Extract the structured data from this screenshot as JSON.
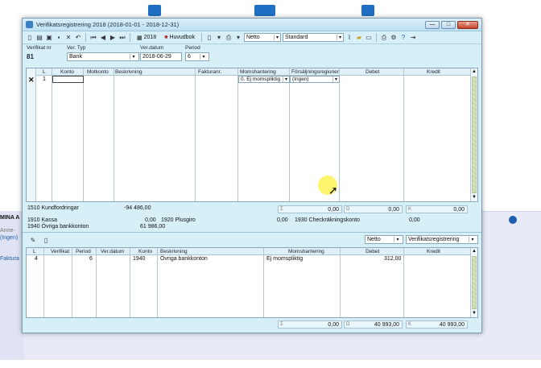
{
  "window": {
    "title": "Verifikatsregistrering 2018 (2018-01-01 - 2018-12-31)",
    "min": "—",
    "max": "□",
    "close": "✕"
  },
  "toolbar": {
    "year_label": "2018",
    "huvudbok_label": "Huvudbok",
    "netto_value": "Netto",
    "standard_value": "Standard"
  },
  "header": {
    "verifikat_label": "Verifikat nr",
    "verifikat_value": "81",
    "vertyp_label": "Ver. Typ",
    "vertyp_value": "Bank",
    "verdatum_label": "Ver.datum",
    "verdatum_value": "2018-06-29",
    "period_label": "Period",
    "period_value": "6"
  },
  "entry_grid": {
    "columns": [
      "L",
      "Konto",
      "Motkonto",
      "Beskrivning",
      "Fakturanr.",
      "Momshantering",
      "Försäljningsregioner",
      "Debet",
      "Kredit"
    ],
    "row": {
      "line": "1",
      "moms": "0. Ej momspliktig",
      "region": "(Ingen)"
    }
  },
  "entry_totals": {
    "sum1": "0,00",
    "sum2": "0,00",
    "sum3": "0,00"
  },
  "accounts": {
    "a1510": "1510 Kundfordringar",
    "a1510_val": "-94 486,00",
    "a1910": "1910 Kassa",
    "a1910_val": "0,00",
    "a1920": "1920 Plusgiro",
    "a1920_val": "0,00",
    "a1930": "1930 Checkräkningskonto",
    "a1930_val": "0,00",
    "a1940": "1940 Övriga bankkonton",
    "a1940_val": "61 986,00"
  },
  "lower_toolbar": {
    "netto_value": "Netto",
    "view_value": "Verifikatsregistrering"
  },
  "lower_grid": {
    "columns": [
      "L",
      "Verifikat",
      "Period",
      "Ver.datum",
      "Konto",
      "Beskrivning",
      "Momshantering",
      "Debet",
      "Kredit"
    ],
    "rows": [
      {
        "line": "4",
        "verifikat": "",
        "period": "6",
        "verdatum": "",
        "konto": "1940",
        "beskrivning": "Övriga bankkonton",
        "moms": "Ej momspliktig",
        "debet": "312,00",
        "kredit": ""
      }
    ]
  },
  "lower_totals": {
    "sum1": "0,00",
    "sum2": "40 993,00",
    "sum3": "40 993,00"
  },
  "background": {
    "panel_title": "MINA A",
    "line1": "Anne-",
    "line2": "(Ingen)",
    "line3": "Faktura"
  }
}
